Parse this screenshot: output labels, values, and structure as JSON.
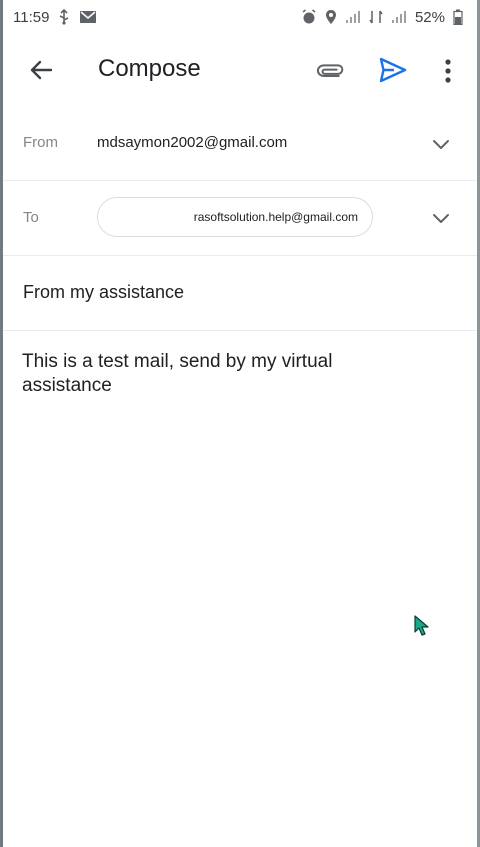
{
  "status_bar": {
    "time": "11:59",
    "battery": "52%"
  },
  "app_bar": {
    "title": "Compose"
  },
  "compose": {
    "from_label": "From",
    "from_value": "mdsaymon2002@gmail.com",
    "to_label": "To",
    "to_value": "rasoftsolution.help@gmail.com",
    "subject": "From my assistance",
    "body": "This is a test mail, send by my virtual assistance"
  },
  "colors": {
    "send_accent": "#1a73e8",
    "divider": "#e8eaed",
    "cursor": "#1aa88a"
  }
}
